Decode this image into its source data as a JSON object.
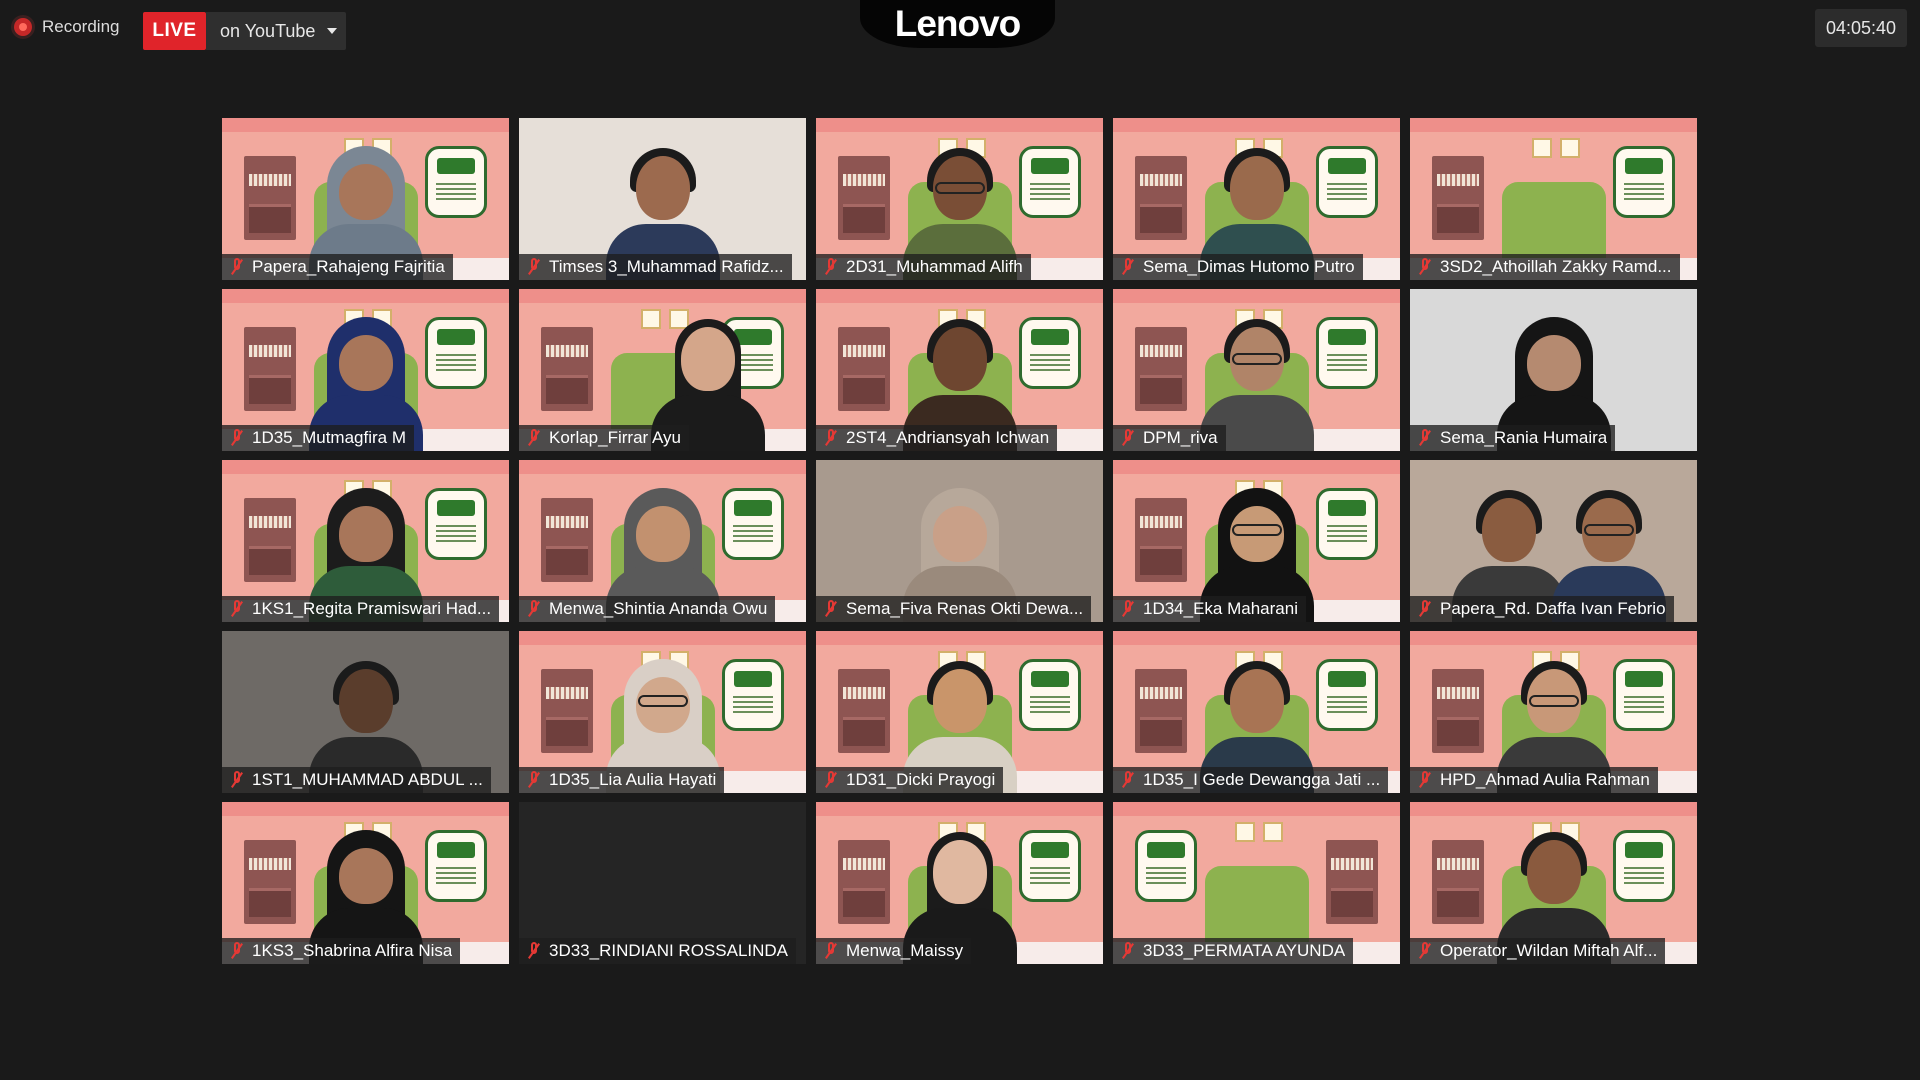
{
  "recording": {
    "label": "Recording"
  },
  "stream": {
    "live_label": "LIVE",
    "platform_label": "on YouTube"
  },
  "brand": {
    "logo_text": "Lenovo"
  },
  "timer": {
    "elapsed": "04:05:40"
  },
  "colors": {
    "live_red": "#e0242a",
    "muted_mic_red": "#e53935",
    "background": "#1a1a1a"
  },
  "participants": [
    {
      "name": "Papera_Rahajeng Fajritia",
      "mic": "muted"
    },
    {
      "name": "Timses 3_Muhammad Rafidz...",
      "mic": "muted"
    },
    {
      "name": "2D31_Muhammad Alifh",
      "mic": "muted"
    },
    {
      "name": "Sema_Dimas Hutomo Putro",
      "mic": "muted"
    },
    {
      "name": "3SD2_Athoillah Zakky Ramd...",
      "mic": "muted"
    },
    {
      "name": "1D35_Mutmagfira M",
      "mic": "muted"
    },
    {
      "name": "Korlap_Firrar Ayu",
      "mic": "muted"
    },
    {
      "name": "2ST4_Andriansyah Ichwan",
      "mic": "muted"
    },
    {
      "name": "DPM_riva",
      "mic": "muted"
    },
    {
      "name": "Sema_Rania Humaira",
      "mic": "muted"
    },
    {
      "name": "1KS1_Regita Pramiswari Had...",
      "mic": "muted"
    },
    {
      "name": "Menwa_Shintia Ananda Owu",
      "mic": "muted"
    },
    {
      "name": "Sema_Fiva Renas Okti Dewa...",
      "mic": "muted"
    },
    {
      "name": "1D34_Eka Maharani",
      "mic": "muted"
    },
    {
      "name": "Papera_Rd. Daffa Ivan Febrio",
      "mic": "muted"
    },
    {
      "name": "1ST1_MUHAMMAD ABDUL ...",
      "mic": "muted"
    },
    {
      "name": "1D35_Lia Aulia Hayati",
      "mic": "muted"
    },
    {
      "name": "1D31_Dicki Prayogi",
      "mic": "muted"
    },
    {
      "name": "1D35_I Gede Dewangga Jati ...",
      "mic": "muted"
    },
    {
      "name": "HPD_Ahmad Aulia Rahman",
      "mic": "muted"
    },
    {
      "name": "1KS3_Shabrina Alfira Nisa",
      "mic": "muted"
    },
    {
      "name": "3D33_RINDIANI ROSSALINDA",
      "mic": "muted"
    },
    {
      "name": "Menwa_Maissy",
      "mic": "muted"
    },
    {
      "name": "3D33_PERMATA AYUNDA",
      "mic": "muted"
    },
    {
      "name": "Operator_Wildan Miftah Alf...",
      "mic": "muted"
    }
  ]
}
